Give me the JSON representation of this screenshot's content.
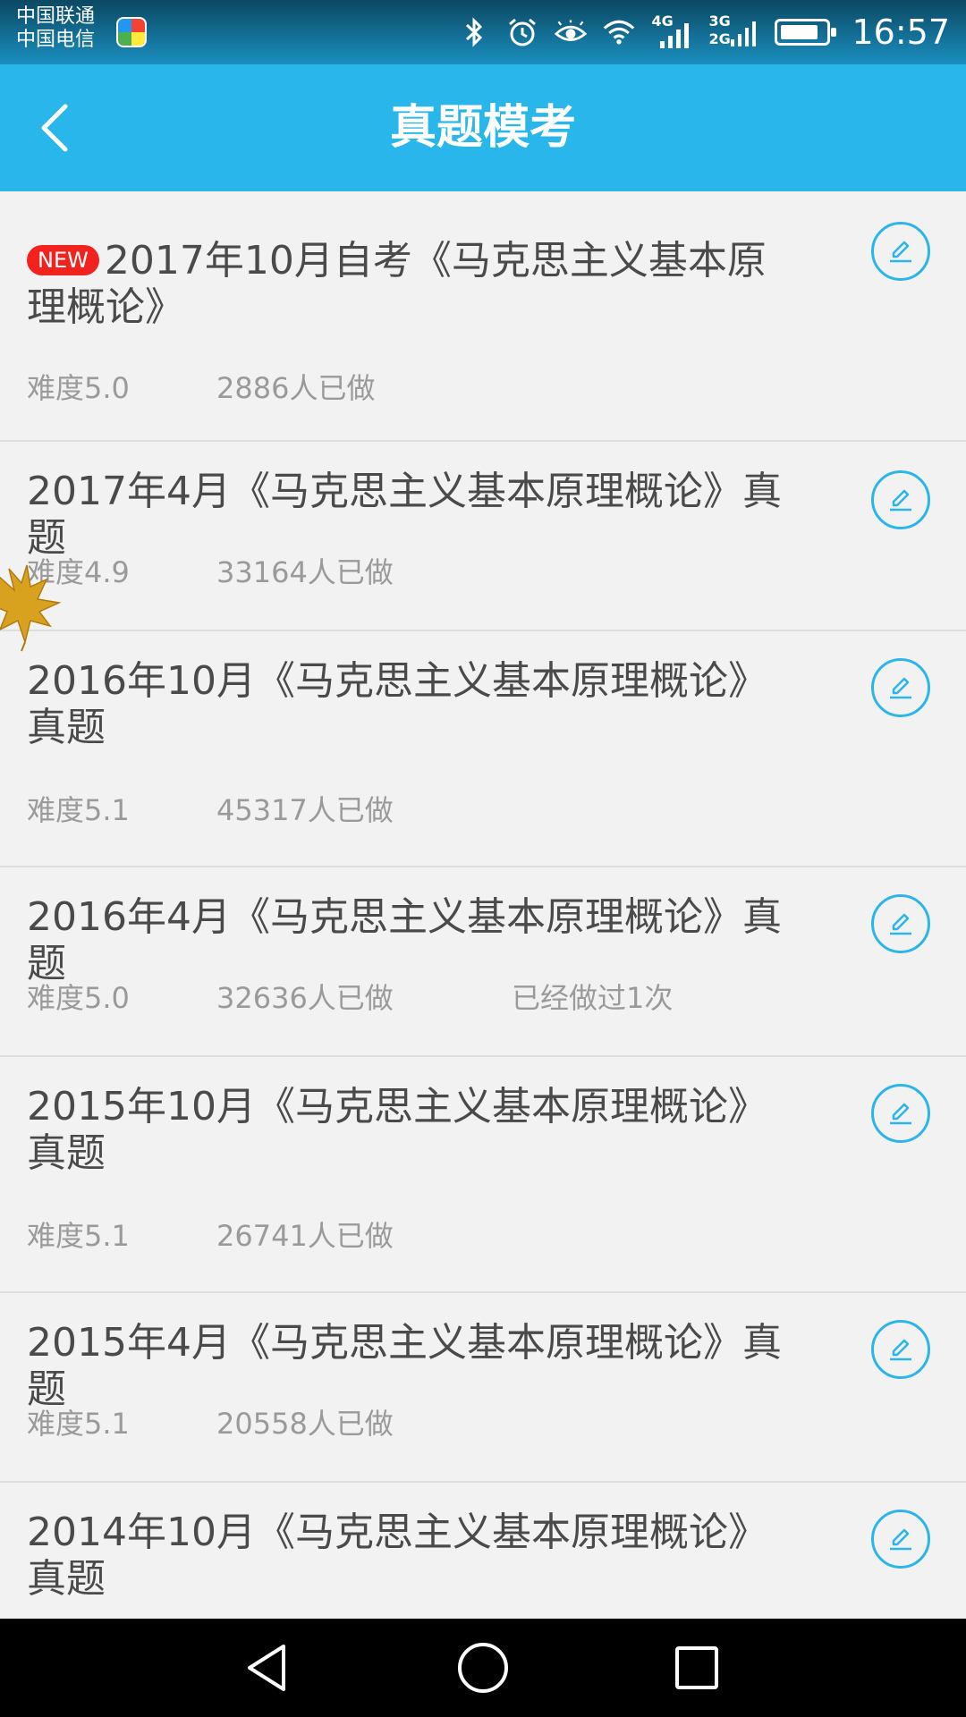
{
  "status_bar": {
    "carrier_1": "中国联通",
    "carrier_2": "中国电信",
    "net_4g": "4G",
    "net_3g": "3G",
    "net_2g": "2G",
    "time": "16:57",
    "battery_level": 0.85
  },
  "app_bar": {
    "title": "真题模考"
  },
  "list": {
    "items": [
      {
        "badge": "NEW",
        "title": "2017年10月自考《马克思主义基本原理概论》",
        "difficulty": "难度5.0",
        "done_count": "2886人已做",
        "times_done": ""
      },
      {
        "badge": "",
        "title": "2017年4月《马克思主义基本原理概论》真题",
        "difficulty": "难度4.9",
        "done_count": "33164人已做",
        "times_done": ""
      },
      {
        "badge": "",
        "title": "2016年10月《马克思主义基本原理概论》真题",
        "difficulty": "难度5.1",
        "done_count": "45317人已做",
        "times_done": ""
      },
      {
        "badge": "",
        "title": "2016年4月《马克思主义基本原理概论》真题",
        "difficulty": "难度5.0",
        "done_count": "32636人已做",
        "times_done": "已经做过1次"
      },
      {
        "badge": "",
        "title": "2015年10月《马克思主义基本原理概论》真题",
        "difficulty": "难度5.1",
        "done_count": "26741人已做",
        "times_done": ""
      },
      {
        "badge": "",
        "title": "2015年4月《马克思主义基本原理概论》真题",
        "difficulty": "难度5.1",
        "done_count": "20558人已做",
        "times_done": ""
      },
      {
        "badge": "",
        "title": "2014年10月《马克思主义基本原理概论》真题",
        "difficulty": "",
        "done_count": "",
        "times_done": ""
      }
    ]
  },
  "icons": {
    "back": "chevron-left-icon",
    "edit": "pencil-icon",
    "nav_back": "triangle-back-icon",
    "nav_home": "circle-home-icon",
    "nav_recents": "square-recents-icon"
  },
  "colors": {
    "accent": "#29b6ea",
    "badge_red": "#f2231e",
    "title_text": "#4a4a4a",
    "meta_text": "#9a9a9a"
  }
}
